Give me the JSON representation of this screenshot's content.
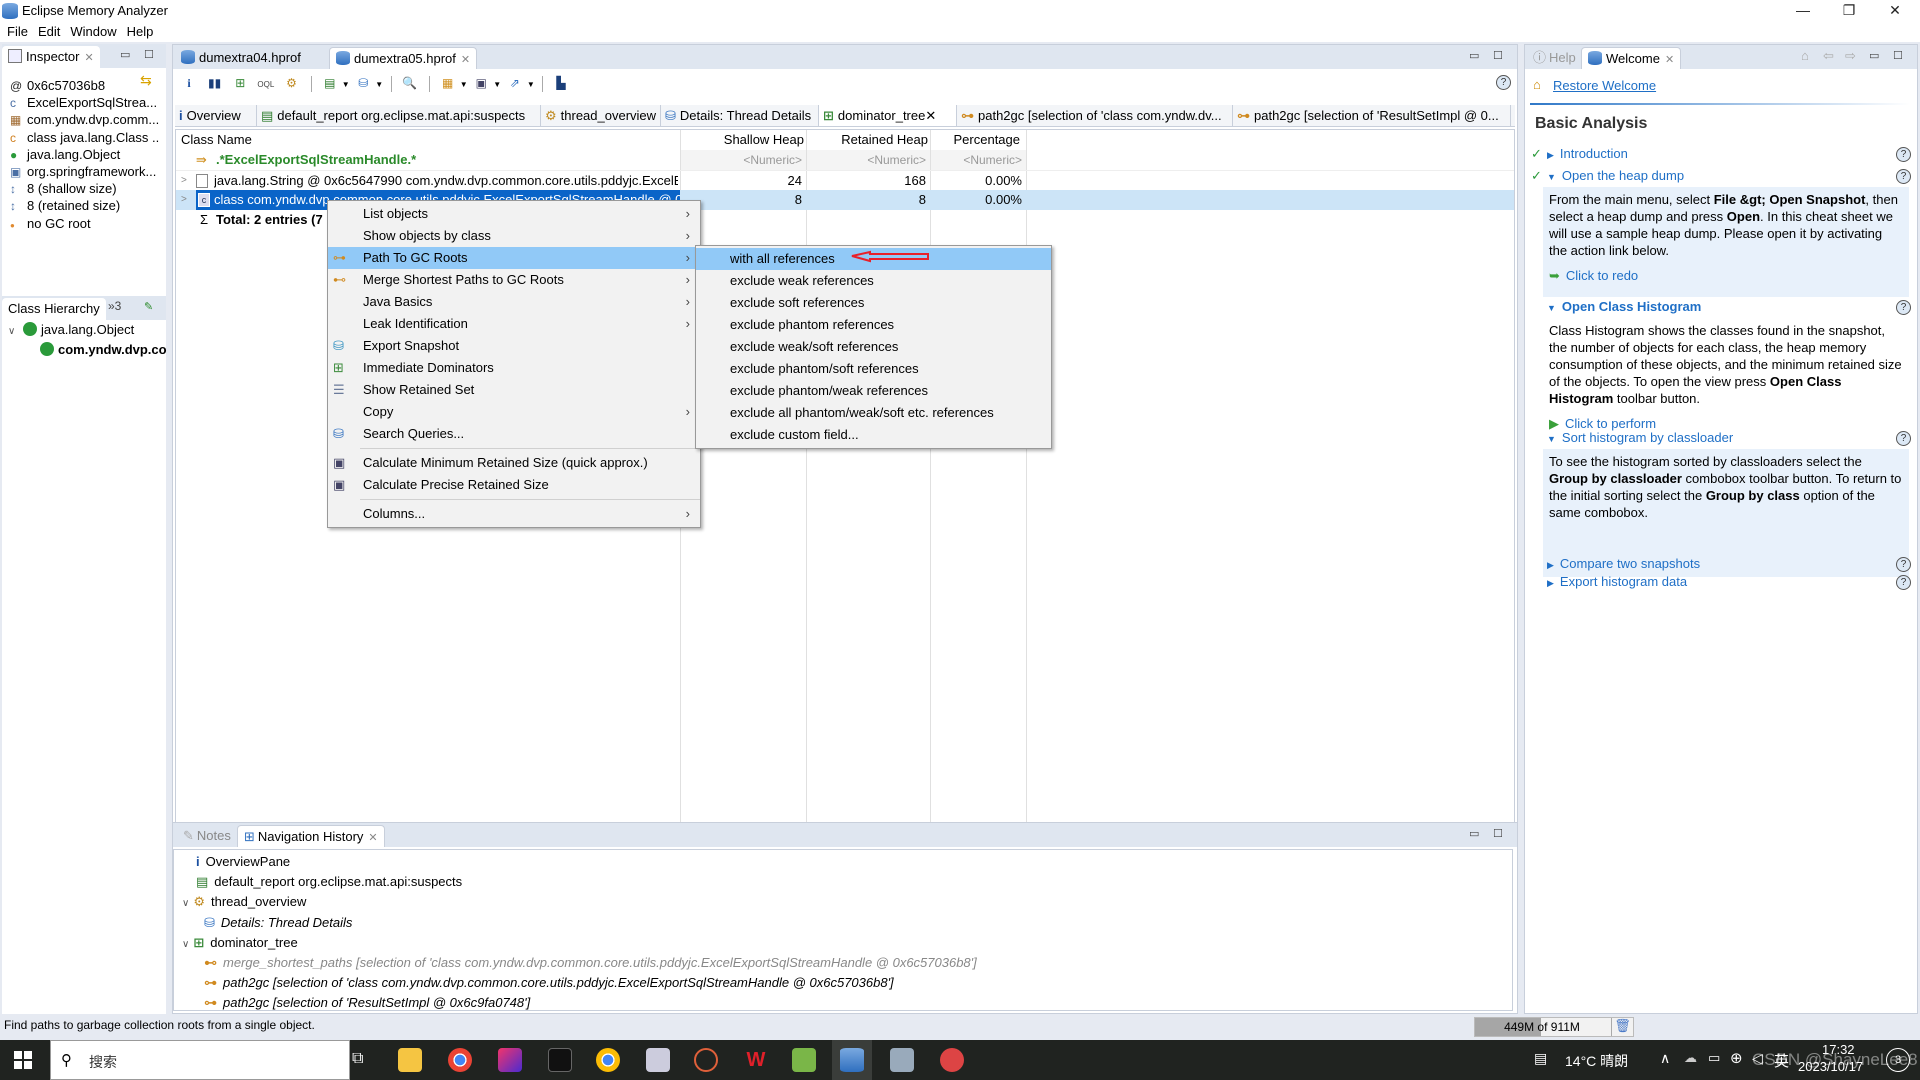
{
  "window": {
    "title": "Eclipse Memory Analyzer",
    "minimize": "—",
    "restore": "❐",
    "close": "✕"
  },
  "menubar": [
    "File",
    "Edit",
    "Window",
    "Help"
  ],
  "inspector": {
    "tab_label": "Inspector",
    "items": [
      {
        "icon": "at-icon",
        "label": "0x6c57036b8"
      },
      {
        "icon": "class-icon",
        "label": "ExcelExportSqlStrea..."
      },
      {
        "icon": "package-icon",
        "label": "com.yndw.dvp.comm..."
      },
      {
        "icon": "class-object-icon",
        "label": "class java.lang.Class ..."
      },
      {
        "icon": "superclass-icon",
        "label": "java.lang.Object"
      },
      {
        "icon": "classloader-icon",
        "label": "org.springframework..."
      },
      {
        "icon": "size-icon",
        "label": "8 (shallow size)"
      },
      {
        "icon": "size-icon",
        "label": "8 (retained size)"
      },
      {
        "icon": "gc-root-icon",
        "label": "no GC root"
      }
    ],
    "bottom_tab": "Class Hierarchy",
    "overflow": "»3",
    "hierarchy": [
      {
        "label": "java.lang.Object",
        "expanded": true
      },
      {
        "label": "com.yndw.dvp.co",
        "bold": true
      }
    ]
  },
  "editor_tabs": [
    {
      "label": "dumextra04.hprof",
      "active": false
    },
    {
      "label": "dumextra05.hprof",
      "active": true
    }
  ],
  "query_tabs": [
    {
      "label": "Overview",
      "icon": "info-icon"
    },
    {
      "label": "default_report  org.eclipse.mat.api:suspects",
      "icon": "report-icon"
    },
    {
      "label": "thread_overview",
      "icon": "gear-icon"
    },
    {
      "label": "Details: Thread Details",
      "icon": "db-gear-icon"
    },
    {
      "label": "dominator_tree",
      "icon": "tree-icon",
      "active": true
    },
    {
      "label": "path2gc  [selection of 'class com.yndw.dv...",
      "icon": "path-icon"
    },
    {
      "label": "path2gc  [selection of 'ResultSetImpl @ 0...",
      "icon": "path-icon"
    }
  ],
  "table": {
    "columns": [
      "Class Name",
      "Shallow Heap",
      "Retained Heap",
      "Percentage"
    ],
    "filter": {
      "name": ".*ExcelExportSqlStreamHandle.*",
      "shallow": "<Numeric>",
      "retained": "<Numeric>",
      "percentage": "<Numeric>"
    },
    "rows": [
      {
        "name": "java.lang.String @ 0x6c5647990  com.yndw.dvp.common.core.utils.pddyjc.ExcelE",
        "shallow": "24",
        "retained": "168",
        "percentage": "0.00%",
        "selected": false
      },
      {
        "name": "class com.yndw.dvp.common.core.utils.pddyjc.ExcelExportSqlStreamHandle @ 0",
        "shallow": "8",
        "retained": "8",
        "percentage": "0.00%",
        "selected": true
      }
    ],
    "total": "Total: 2 entries (7"
  },
  "context_menu": {
    "items": [
      {
        "label": "List objects",
        "submenu": true
      },
      {
        "label": "Show objects by class",
        "submenu": true
      },
      {
        "label": "Path To GC Roots",
        "submenu": true,
        "selected": true,
        "icon": "path-icon"
      },
      {
        "label": "Merge Shortest Paths to GC Roots",
        "submenu": true,
        "icon": "merge-icon"
      },
      {
        "label": "Java Basics",
        "submenu": true
      },
      {
        "label": "Leak Identification",
        "submenu": true
      },
      {
        "label": "Export Snapshot",
        "icon": "export-icon"
      },
      {
        "label": "Immediate Dominators",
        "icon": "dominator-icon"
      },
      {
        "label": "Show Retained Set",
        "icon": "retained-icon"
      },
      {
        "label": "Copy",
        "submenu": true
      },
      {
        "label": "Search Queries...",
        "icon": "search-queries-icon"
      },
      {
        "separator": true
      },
      {
        "label": "Calculate Minimum Retained Size (quick approx.)",
        "icon": "calculator-icon"
      },
      {
        "label": "Calculate Precise Retained Size",
        "icon": "calculator-icon"
      },
      {
        "separator": true
      },
      {
        "label": "Columns...",
        "submenu": true
      }
    ]
  },
  "submenu": {
    "items": [
      "with all references",
      "exclude weak references",
      "exclude soft references",
      "exclude phantom references",
      "exclude weak/soft references",
      "exclude phantom/soft references",
      "exclude phantom/weak references",
      "exclude all phantom/weak/soft etc. references",
      "exclude custom field..."
    ],
    "annotation_color": "#e8202a"
  },
  "bottom_panel": {
    "tabs": [
      {
        "label": "Notes",
        "active": false
      },
      {
        "label": "Navigation History",
        "active": true
      }
    ],
    "history": [
      {
        "label": "OverviewPane",
        "level": 0,
        "icon": "info-icon"
      },
      {
        "label": "default_report  org.eclipse.mat.api:suspects",
        "level": 0,
        "icon": "report-icon"
      },
      {
        "label": "thread_overview",
        "level": 0,
        "icon": "gear-icon",
        "expanded": true
      },
      {
        "label": "Details: Thread Details",
        "level": 1,
        "icon": "db-gear-icon",
        "italic": true
      },
      {
        "label": "dominator_tree",
        "level": 0,
        "icon": "tree-icon",
        "expanded": true
      },
      {
        "label": "merge_shortest_paths  [selection of 'class com.yndw.dvp.common.core.utils.pddyjc.ExcelExportSqlStreamHandle @ 0x6c57036b8']",
        "level": 1,
        "icon": "merge-icon",
        "italic": true,
        "grey": true
      },
      {
        "label": "path2gc  [selection of 'class com.yndw.dvp.common.core.utils.pddyjc.ExcelExportSqlStreamHandle @ 0x6c57036b8']",
        "level": 1,
        "icon": "path-icon",
        "italic": true
      },
      {
        "label": "path2gc  [selection of 'ResultSetImpl @ 0x6c9fa0748']",
        "level": 1,
        "icon": "path-icon",
        "italic": true
      }
    ]
  },
  "welcome": {
    "tabs": [
      {
        "label": "Help",
        "active": false
      },
      {
        "label": "Welcome",
        "active": true
      }
    ],
    "restore_link": "Restore Welcome",
    "heading": "Basic Analysis",
    "sections": [
      {
        "title": "Introduction",
        "done": true,
        "expanded": false
      },
      {
        "title": "Open the heap dump",
        "done": true,
        "expanded": true,
        "body": [
          "From the main menu, select ",
          "File &gt; Open Snapshot",
          ", then select a heap dump and press ",
          "Open",
          ". In this cheat sheet we will use a sample heap dump. Please open it by activating the action link below."
        ],
        "action": "Click to redo"
      },
      {
        "title": "Open Class Histogram",
        "done": false,
        "expanded": true,
        "bold": true,
        "body": [
          "Class Histogram shows the classes found in the snapshot, the number of objects for each class, the heap memory consumption of these objects, and the minimum retained size of the objects. To open the view press ",
          "Open Class Histogram",
          " toolbar button."
        ],
        "action": "Click to perform"
      },
      {
        "title": "Sort histogram by classloader",
        "done": false,
        "expanded": true,
        "body": [
          "To see the histogram sorted by classloaders select the ",
          "Group by classloader",
          " combobox toolbar button. To return to the initial sorting select the ",
          "Group by class",
          " option of the same combobox."
        ]
      },
      {
        "title": "Compare two snapshots",
        "done": false,
        "expanded": false
      },
      {
        "title": "Export histogram data",
        "done": false,
        "expanded": false
      }
    ]
  },
  "statusbar": {
    "message": "Find paths to garbage collection roots from a single object.",
    "heap_label": "449M of 911M",
    "heap_used_fraction": 0.493
  },
  "taskbar": {
    "search_placeholder": "搜索",
    "weather": "14°C  晴朗",
    "ime": "英",
    "time": "17:32",
    "date": "2023/10/17",
    "watermark": "CSDN @ShayneLee8",
    "notifications": "3"
  }
}
